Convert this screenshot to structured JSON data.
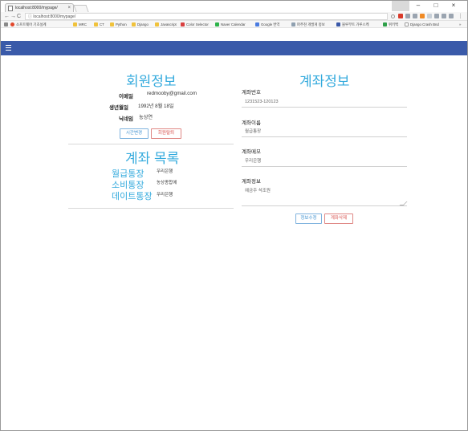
{
  "browser": {
    "tab_title": "localhost:8000/mypage/",
    "url": "localhost:8000/mypage/",
    "bookmarks": [
      {
        "label": "소프트웨어 기초설계",
        "color": "#e2472b"
      },
      {
        "label": "MRC",
        "color": "#f0c23b"
      },
      {
        "label": "CT",
        "color": "#f0c23b"
      },
      {
        "label": "Python",
        "color": "#f0c23b"
      },
      {
        "label": "Django",
        "color": "#f0c23b"
      },
      {
        "label": "Javascript",
        "color": "#f0c23b"
      },
      {
        "label": "Color Selector",
        "color": "#d94040"
      },
      {
        "label": "Naver Calendar",
        "color": "#2db34a"
      },
      {
        "label": "Google 번역",
        "color": "#4a7be0"
      },
      {
        "label": "파주천 개발게 정보",
        "color": "#8fa0b0"
      },
      {
        "label": "블루부트 가루스케",
        "color": "#3a58a8"
      },
      {
        "label": "위키백",
        "color": "#2fa04a"
      },
      {
        "label": "Django Crash Bnd",
        "color": "#999999"
      }
    ]
  },
  "member": {
    "title": "회원정보",
    "fields": [
      {
        "label": "이메일",
        "value": "redmooby@gmail.com"
      },
      {
        "label": "생년월일",
        "value": "1992년 8월 18일"
      },
      {
        "label": "닉네임",
        "value": "농상연"
      }
    ],
    "edit_button": "시간변경",
    "withdraw_button": "회원탈퇴"
  },
  "accounts": {
    "title": "계좌 목록",
    "items": [
      {
        "name": "월급통장",
        "bank": "우리은행"
      },
      {
        "name": "소비통장",
        "bank": "농상종합에"
      },
      {
        "name": "데이트통장",
        "bank": "우리은행"
      }
    ]
  },
  "account_info": {
    "title": "계좌정보",
    "fields": [
      {
        "label": "계좌번호",
        "placeholder": "1231523-120123"
      },
      {
        "label": "계좌이름",
        "placeholder": "월급통장"
      },
      {
        "label": "계좌메모",
        "placeholder": "우리은행"
      }
    ],
    "detail_label": "계좌정보",
    "detail_placeholder": "예금주 석조원",
    "edit_button": "정보수정",
    "delete_button": "계좌삭제"
  }
}
